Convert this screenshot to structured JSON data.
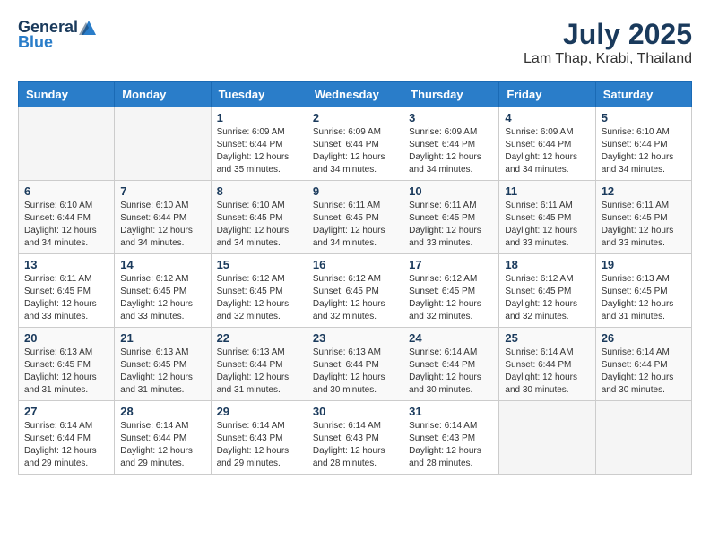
{
  "header": {
    "logo_general": "General",
    "logo_blue": "Blue",
    "month_year": "July 2025",
    "location": "Lam Thap, Krabi, Thailand"
  },
  "calendar": {
    "days_of_week": [
      "Sunday",
      "Monday",
      "Tuesday",
      "Wednesday",
      "Thursday",
      "Friday",
      "Saturday"
    ],
    "weeks": [
      [
        {
          "day": "",
          "info": ""
        },
        {
          "day": "",
          "info": ""
        },
        {
          "day": "1",
          "info": "Sunrise: 6:09 AM\nSunset: 6:44 PM\nDaylight: 12 hours\nand 35 minutes."
        },
        {
          "day": "2",
          "info": "Sunrise: 6:09 AM\nSunset: 6:44 PM\nDaylight: 12 hours\nand 34 minutes."
        },
        {
          "day": "3",
          "info": "Sunrise: 6:09 AM\nSunset: 6:44 PM\nDaylight: 12 hours\nand 34 minutes."
        },
        {
          "day": "4",
          "info": "Sunrise: 6:09 AM\nSunset: 6:44 PM\nDaylight: 12 hours\nand 34 minutes."
        },
        {
          "day": "5",
          "info": "Sunrise: 6:10 AM\nSunset: 6:44 PM\nDaylight: 12 hours\nand 34 minutes."
        }
      ],
      [
        {
          "day": "6",
          "info": "Sunrise: 6:10 AM\nSunset: 6:44 PM\nDaylight: 12 hours\nand 34 minutes."
        },
        {
          "day": "7",
          "info": "Sunrise: 6:10 AM\nSunset: 6:44 PM\nDaylight: 12 hours\nand 34 minutes."
        },
        {
          "day": "8",
          "info": "Sunrise: 6:10 AM\nSunset: 6:45 PM\nDaylight: 12 hours\nand 34 minutes."
        },
        {
          "day": "9",
          "info": "Sunrise: 6:11 AM\nSunset: 6:45 PM\nDaylight: 12 hours\nand 34 minutes."
        },
        {
          "day": "10",
          "info": "Sunrise: 6:11 AM\nSunset: 6:45 PM\nDaylight: 12 hours\nand 33 minutes."
        },
        {
          "day": "11",
          "info": "Sunrise: 6:11 AM\nSunset: 6:45 PM\nDaylight: 12 hours\nand 33 minutes."
        },
        {
          "day": "12",
          "info": "Sunrise: 6:11 AM\nSunset: 6:45 PM\nDaylight: 12 hours\nand 33 minutes."
        }
      ],
      [
        {
          "day": "13",
          "info": "Sunrise: 6:11 AM\nSunset: 6:45 PM\nDaylight: 12 hours\nand 33 minutes."
        },
        {
          "day": "14",
          "info": "Sunrise: 6:12 AM\nSunset: 6:45 PM\nDaylight: 12 hours\nand 33 minutes."
        },
        {
          "day": "15",
          "info": "Sunrise: 6:12 AM\nSunset: 6:45 PM\nDaylight: 12 hours\nand 32 minutes."
        },
        {
          "day": "16",
          "info": "Sunrise: 6:12 AM\nSunset: 6:45 PM\nDaylight: 12 hours\nand 32 minutes."
        },
        {
          "day": "17",
          "info": "Sunrise: 6:12 AM\nSunset: 6:45 PM\nDaylight: 12 hours\nand 32 minutes."
        },
        {
          "day": "18",
          "info": "Sunrise: 6:12 AM\nSunset: 6:45 PM\nDaylight: 12 hours\nand 32 minutes."
        },
        {
          "day": "19",
          "info": "Sunrise: 6:13 AM\nSunset: 6:45 PM\nDaylight: 12 hours\nand 31 minutes."
        }
      ],
      [
        {
          "day": "20",
          "info": "Sunrise: 6:13 AM\nSunset: 6:45 PM\nDaylight: 12 hours\nand 31 minutes."
        },
        {
          "day": "21",
          "info": "Sunrise: 6:13 AM\nSunset: 6:45 PM\nDaylight: 12 hours\nand 31 minutes."
        },
        {
          "day": "22",
          "info": "Sunrise: 6:13 AM\nSunset: 6:44 PM\nDaylight: 12 hours\nand 31 minutes."
        },
        {
          "day": "23",
          "info": "Sunrise: 6:13 AM\nSunset: 6:44 PM\nDaylight: 12 hours\nand 30 minutes."
        },
        {
          "day": "24",
          "info": "Sunrise: 6:14 AM\nSunset: 6:44 PM\nDaylight: 12 hours\nand 30 minutes."
        },
        {
          "day": "25",
          "info": "Sunrise: 6:14 AM\nSunset: 6:44 PM\nDaylight: 12 hours\nand 30 minutes."
        },
        {
          "day": "26",
          "info": "Sunrise: 6:14 AM\nSunset: 6:44 PM\nDaylight: 12 hours\nand 30 minutes."
        }
      ],
      [
        {
          "day": "27",
          "info": "Sunrise: 6:14 AM\nSunset: 6:44 PM\nDaylight: 12 hours\nand 29 minutes."
        },
        {
          "day": "28",
          "info": "Sunrise: 6:14 AM\nSunset: 6:44 PM\nDaylight: 12 hours\nand 29 minutes."
        },
        {
          "day": "29",
          "info": "Sunrise: 6:14 AM\nSunset: 6:43 PM\nDaylight: 12 hours\nand 29 minutes."
        },
        {
          "day": "30",
          "info": "Sunrise: 6:14 AM\nSunset: 6:43 PM\nDaylight: 12 hours\nand 28 minutes."
        },
        {
          "day": "31",
          "info": "Sunrise: 6:14 AM\nSunset: 6:43 PM\nDaylight: 12 hours\nand 28 minutes."
        },
        {
          "day": "",
          "info": ""
        },
        {
          "day": "",
          "info": ""
        }
      ]
    ]
  }
}
